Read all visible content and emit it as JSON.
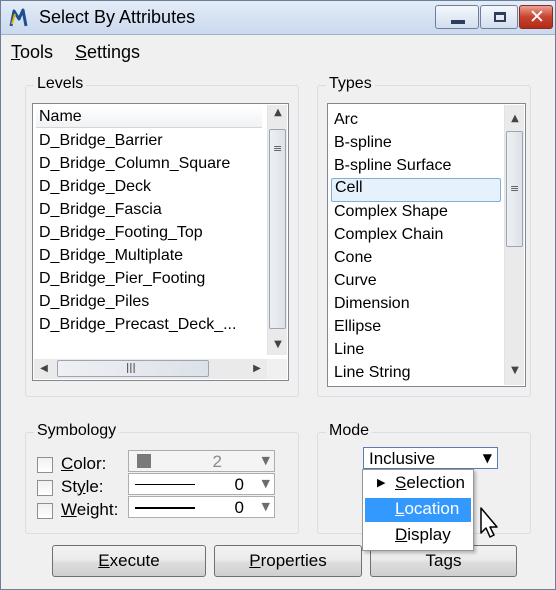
{
  "window": {
    "title": "Select By Attributes",
    "close_glyph": "✕"
  },
  "menu": {
    "tools": {
      "accel": "T",
      "rest": "ools"
    },
    "settings": {
      "accel": "S",
      "rest": "ettings"
    }
  },
  "levels": {
    "group_label": "Levels",
    "column_header": "Name",
    "items": [
      "D_Bridge_Barrier",
      "D_Bridge_Column_Square",
      "D_Bridge_Deck",
      "D_Bridge_Fascia",
      "D_Bridge_Footing_Top",
      "D_Bridge_Multiplate",
      "D_Bridge_Pier_Footing",
      "D_Bridge_Piles",
      "D_Bridge_Precast_Deck_..."
    ]
  },
  "types": {
    "group_label": "Types",
    "selected": "Cell",
    "items": [
      "Arc",
      "B-spline",
      "B-spline Surface",
      "Cell",
      "Complex Shape",
      "Complex Chain",
      "Cone",
      "Curve",
      "Dimension",
      "Ellipse",
      "Line",
      "Line String"
    ]
  },
  "symbology": {
    "group_label": "Symbology",
    "color": {
      "accel": "C",
      "rest": "olor:",
      "value": "2",
      "checked": false,
      "swatch_color": "#7a7a7a"
    },
    "style": {
      "pre": "St",
      "accel": "y",
      "rest": "le:",
      "value": "0",
      "checked": false
    },
    "weight": {
      "accel": "W",
      "rest": "eight:",
      "value": "0",
      "checked": false
    }
  },
  "mode": {
    "group_label": "Mode",
    "selected": "Inclusive",
    "menu_open": true,
    "options": [
      {
        "accel": "S",
        "rest": "election",
        "submenu": true
      },
      {
        "accel": "L",
        "rest": "ocation",
        "highlighted": true
      },
      {
        "accel": "D",
        "rest": "isplay"
      }
    ]
  },
  "buttons": {
    "execute": {
      "accel": "E",
      "rest": "xecute"
    },
    "properties": {
      "accel": "P",
      "rest": "roperties"
    },
    "tags": {
      "pre": "Ta",
      "accel": "g",
      "rest": "s"
    }
  },
  "colors": {
    "highlight": "#3399ff",
    "selection_bg": "#e5f1fb",
    "close_button": "#c7432e"
  },
  "icons": {
    "app": "microstation-m-icon",
    "minimize": "minimize-icon",
    "maximize": "maximize-icon",
    "close": "close-icon",
    "cursor": "mouse-pointer-icon"
  }
}
